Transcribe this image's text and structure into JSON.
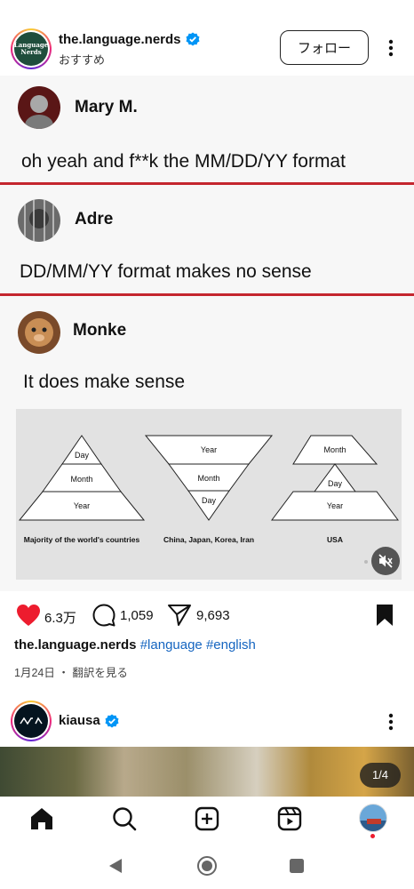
{
  "post": {
    "username": "the.language.nerds",
    "subtitle": "おすすめ",
    "follow_label": "フォロー",
    "avatar_text": "Language Nerds"
  },
  "comments": [
    {
      "name": "Mary M.",
      "text": "oh yeah and f**k the MM/DD/YY format"
    },
    {
      "name": "Adre",
      "text": "DD/MM/YY format makes no sense"
    },
    {
      "name": "Monke",
      "text": "It does make sense"
    }
  ],
  "diagram": {
    "left": {
      "levels": [
        "Day",
        "Month",
        "Year"
      ],
      "caption": "Majority of the world's countries"
    },
    "middle": {
      "levels": [
        "Year",
        "Month",
        "Day"
      ],
      "caption": "China, Japan, Korea, Iran"
    },
    "right": {
      "levels": [
        "Month",
        "Day",
        "Year"
      ],
      "caption": "USA"
    }
  },
  "actions": {
    "likes": "6.3万",
    "comments": "1,059",
    "shares": "9,693",
    "like_color": "#ed1c2e"
  },
  "caption": {
    "username": "the.language.nerds",
    "hashtags": "#language #english",
    "date": "1月24日",
    "translate": "翻訳を見る"
  },
  "next_post": {
    "username": "kiausa",
    "counter": "1/4"
  },
  "nav": {
    "items": [
      "home-icon",
      "search-icon",
      "create-icon",
      "reels-icon",
      "profile-icon"
    ]
  },
  "colors": {
    "divider": "#c4262e",
    "hashtag": "#1565c0",
    "verified": "#0095f6"
  }
}
